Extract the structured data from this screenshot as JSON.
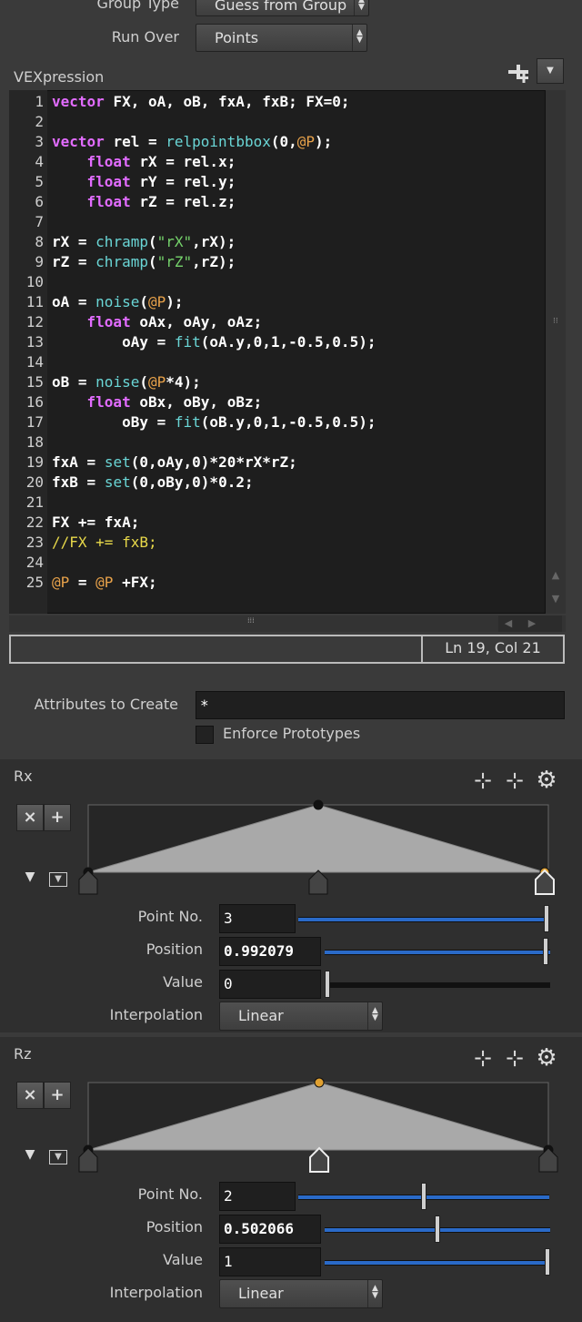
{
  "group_type": {
    "label": "Group Type",
    "value": "Guess from Group"
  },
  "run_over": {
    "label": "Run Over",
    "value": "Points"
  },
  "vex": {
    "label": "VEXpression",
    "lines": [
      {
        "n": "1",
        "t": "vector FX, oA, oB, fxA, fxB; FX=0;"
      },
      {
        "n": "2",
        "t": ""
      },
      {
        "n": "3",
        "t": "vector rel = relpointbbox(0,@P);"
      },
      {
        "n": "4",
        "t": "    float rX = rel.x;"
      },
      {
        "n": "5",
        "t": "    float rY = rel.y;"
      },
      {
        "n": "6",
        "t": "    float rZ = rel.z;"
      },
      {
        "n": "7",
        "t": ""
      },
      {
        "n": "8",
        "t": "rX = chramp(\"rX\",rX);"
      },
      {
        "n": "9",
        "t": "rZ = chramp(\"rZ\",rZ);"
      },
      {
        "n": "10",
        "t": ""
      },
      {
        "n": "11",
        "t": "oA = noise(@P);"
      },
      {
        "n": "12",
        "t": "    float oAx, oAy, oAz;"
      },
      {
        "n": "13",
        "t": "        oAy = fit(oA.y,0,1,-0.5,0.5);"
      },
      {
        "n": "14",
        "t": ""
      },
      {
        "n": "15",
        "t": "oB = noise(@P*4);"
      },
      {
        "n": "16",
        "t": "    float oBx, oBy, oBz;"
      },
      {
        "n": "17",
        "t": "        oBy = fit(oB.y,0,1,-0.5,0.5);"
      },
      {
        "n": "18",
        "t": ""
      },
      {
        "n": "19",
        "t": "fxA = set(0,oAy,0)*20*rX*rZ;"
      },
      {
        "n": "20",
        "t": "fxB = set(0,oBy,0)*0.2;"
      },
      {
        "n": "21",
        "t": ""
      },
      {
        "n": "22",
        "t": "FX += fxA;"
      },
      {
        "n": "23",
        "t": "//FX += fxB;"
      },
      {
        "n": "24",
        "t": ""
      },
      {
        "n": "25",
        "t": "@P = @P +FX;"
      }
    ],
    "status_left": "",
    "status_right": "Ln 19, Col 21"
  },
  "attributes": {
    "label": "Attributes to Create",
    "value": "*"
  },
  "enforce": {
    "label": "Enforce Prototypes",
    "checked": false
  },
  "rx": {
    "title": "Rx",
    "ramp_points": [
      [
        0,
        0
      ],
      [
        0.5,
        1
      ],
      [
        0.992079,
        0
      ]
    ],
    "selected_point": 2,
    "point_no_label": "Point No.",
    "point_no": "3",
    "position_label": "Position",
    "position": "0.992079",
    "value_label": "Value",
    "value": "0",
    "interp_label": "Interpolation",
    "interp": "Linear",
    "point_slider_frac": 1.0,
    "position_slider_frac": 0.992079,
    "value_slider_frac": 0.0
  },
  "rz": {
    "title": "Rz",
    "ramp_points": [
      [
        0,
        0
      ],
      [
        0.502066,
        1
      ],
      [
        1,
        0
      ]
    ],
    "selected_point": 1,
    "point_no_label": "Point No.",
    "point_no": "2",
    "position_label": "Position",
    "position": "0.502066",
    "value_label": "Value",
    "value": "1",
    "interp_label": "Interpolation",
    "interp": "Linear",
    "point_slider_frac": 0.5,
    "position_slider_frac": 0.502066,
    "value_slider_frac": 1.0
  },
  "icons": {
    "add_snippet": "plus-icon",
    "menu": "chevron-down-icon",
    "gear": "gear-icon",
    "delete": "close-icon"
  }
}
